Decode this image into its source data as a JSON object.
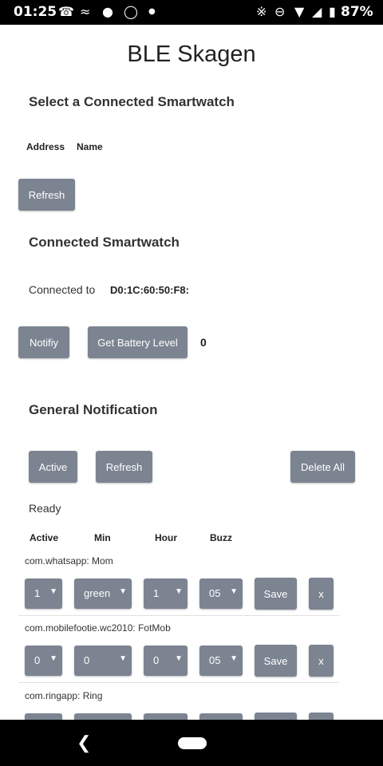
{
  "status_bar": {
    "time": "01:25",
    "battery": "87%"
  },
  "app_title": "BLE Skagen",
  "select_section": {
    "heading": "Select a Connected Smartwatch",
    "columns": [
      "Address",
      "Name"
    ],
    "refresh_label": "Refresh"
  },
  "connected_section": {
    "heading": "Connected Smartwatch",
    "connected_label": "Connected to",
    "address": "D0:1C:60:50:F8:",
    "notify_label": "Notifiy",
    "battery_label": "Get Battery Level",
    "battery_value": "0"
  },
  "general_section": {
    "heading": "General Notification",
    "active_label": "Active",
    "refresh_label": "Refresh",
    "delete_all_label": "Delete All",
    "status": "Ready",
    "columns": [
      "Active",
      "Min",
      "Hour",
      "Buzz"
    ]
  },
  "notifications": [
    {
      "app": "com.whatsapp: Mom",
      "active": "1",
      "min": "green",
      "hour": "1",
      "buzz": "05",
      "save_label": "Save",
      "delete_label": "x"
    },
    {
      "app": "com.mobilefootie.wc2010: FotMob",
      "active": "0",
      "min": "0",
      "hour": "0",
      "buzz": "05",
      "save_label": "Save",
      "delete_label": "x"
    },
    {
      "app": "com.ringapp: Ring",
      "active": "",
      "min": "",
      "hour": "",
      "buzz": "",
      "save_label": "",
      "delete_label": ""
    }
  ],
  "icons": {
    "status_left": [
      "whatsapp-icon",
      "running-icon",
      "snapchat-icon",
      "messenger-icon",
      "dot-icon"
    ],
    "status_right": [
      "bluetooth-icon",
      "do-not-disturb-icon",
      "wifi-icon",
      "signal-icon",
      "battery-icon"
    ],
    "nav": [
      "back-icon",
      "home-icon"
    ]
  }
}
